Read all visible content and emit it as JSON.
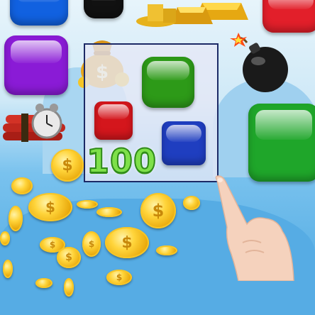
{
  "hud": {
    "score": "100"
  },
  "board": {
    "tiles": [
      {
        "color": "green",
        "hex": "#2d9a18"
      },
      {
        "color": "red",
        "hex": "#d4161c"
      },
      {
        "color": "blue",
        "hex": "#1f3ec0"
      }
    ]
  },
  "decor": {
    "gem_colors": {
      "blue": "#1161e0",
      "black": "#111111",
      "red": "#e21f2a",
      "purple": "#8a1bd6",
      "green": "#1fa62a"
    },
    "icons": [
      "money-bag-icon",
      "bomb-icon",
      "dynamite-clock-icon",
      "gold-bars-icon",
      "coin-icon",
      "pointing-hand-icon"
    ],
    "coin_symbol": "$"
  }
}
